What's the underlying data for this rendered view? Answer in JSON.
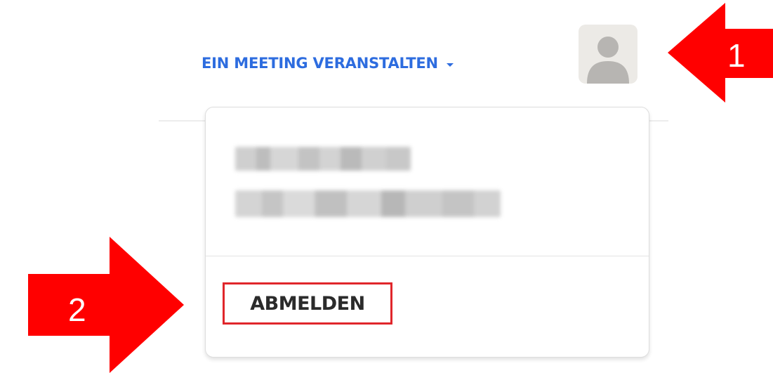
{
  "header": {
    "host_meeting_label": "EIN MEETING VERANSTALTEN",
    "host_meeting_icon": "chevron-down-icon",
    "avatar_icon": "user-avatar-icon"
  },
  "dropdown": {
    "user_name": "",
    "user_email": "",
    "signout_label": "ABMELDEN"
  },
  "annotations": {
    "arrow_1_label": "1",
    "arrow_2_label": "2",
    "highlight_color": "#e0262b",
    "arrow_color": "#ff0000"
  },
  "colors": {
    "link_blue": "#2d6cdf",
    "text_dark": "#2b2b2b",
    "avatar_bg": "#eceae6",
    "avatar_figure": "#b7b5b2"
  }
}
